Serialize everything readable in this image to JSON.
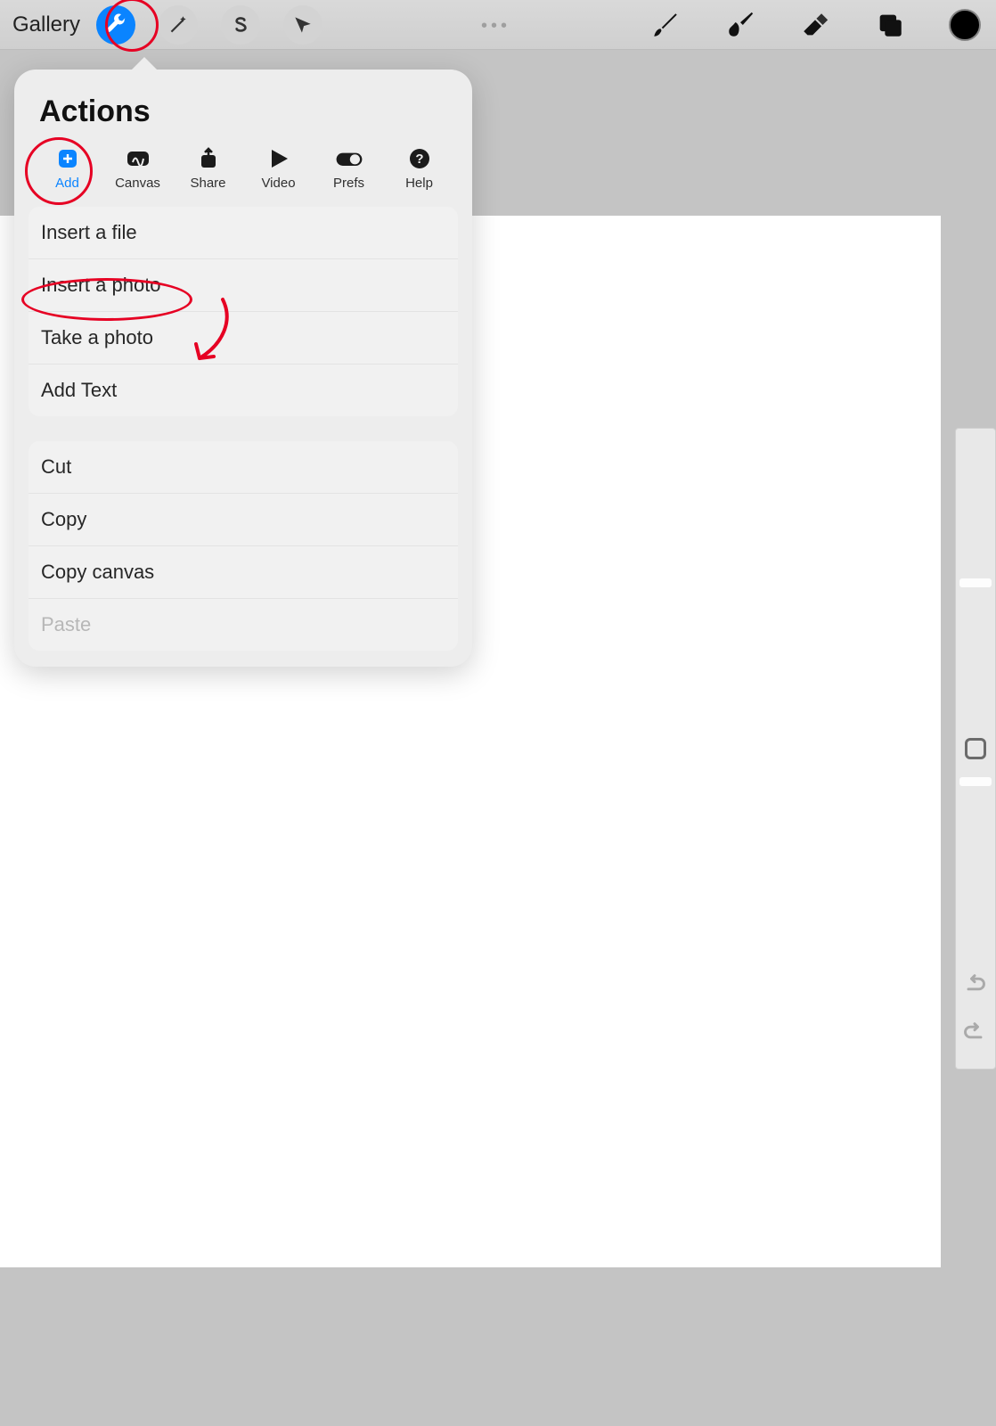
{
  "topbar": {
    "gallery_label": "Gallery"
  },
  "popover": {
    "title": "Actions",
    "tabs": [
      {
        "label": "Add",
        "active": true
      },
      {
        "label": "Canvas",
        "active": false
      },
      {
        "label": "Share",
        "active": false
      },
      {
        "label": "Video",
        "active": false
      },
      {
        "label": "Prefs",
        "active": false
      },
      {
        "label": "Help",
        "active": false
      }
    ],
    "group1": [
      "Insert a file",
      "Insert a photo",
      "Take a photo",
      "Add Text"
    ],
    "group2": [
      {
        "label": "Cut",
        "disabled": false
      },
      {
        "label": "Copy",
        "disabled": false
      },
      {
        "label": "Copy canvas",
        "disabled": false
      },
      {
        "label": "Paste",
        "disabled": true
      }
    ]
  },
  "annotations": {
    "circle_wrench": true,
    "circle_add_tab": true,
    "ellipse_insert_photo": true,
    "arrow": true
  },
  "colors": {
    "accent": "#0a84ff",
    "annotation": "#e60023"
  }
}
